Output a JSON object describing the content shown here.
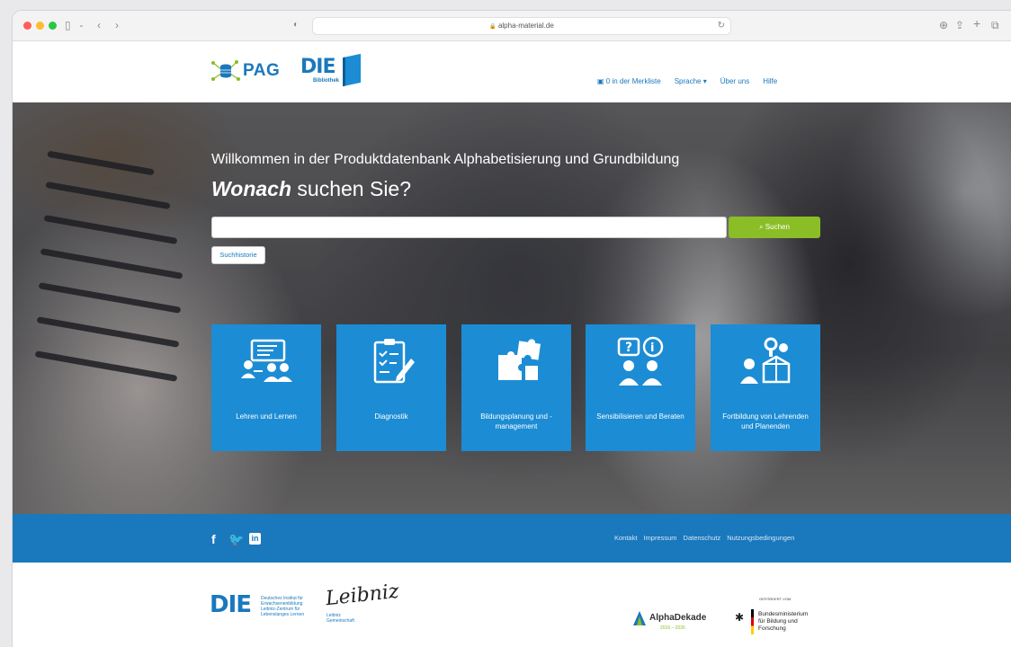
{
  "browser": {
    "url": "alpha-material.de",
    "secure_glyph": "🔒",
    "reload_icon": "↻",
    "shield_icon": "◐"
  },
  "header": {
    "logo_pag": "PAG",
    "logo_die": "DIE",
    "logo_die_sub": "Bibliothek",
    "nav": {
      "merkliste": "0 in der Merkliste",
      "sprache": "Sprache ▾",
      "ueber": "Über uns",
      "hilfe": "Hilfe"
    }
  },
  "hero": {
    "title": "Willkommen in der Produktdatenbank Alphabetisierung und Grundbildung",
    "subtitle_bold": "Wonach",
    "subtitle_rest": " suchen Sie?",
    "search_placeholder": "",
    "search_button": "Suchen",
    "history_button": "Suchhistorie"
  },
  "tiles": [
    {
      "label": "Lehren und Lernen",
      "icon": "teaching-icon"
    },
    {
      "label": "Diagnostik",
      "icon": "clipboard-icon"
    },
    {
      "label": "Bildungsplanung und -management",
      "icon": "puzzle-icon"
    },
    {
      "label": "Sensibilisieren und Beraten",
      "icon": "question-info-icon"
    },
    {
      "label": "Fortbildung von Lehrenden und Planenden",
      "icon": "toolbox-icon"
    }
  ],
  "footer": {
    "social": [
      "facebook-icon",
      "twitter-icon",
      "linkedin-icon"
    ],
    "links": [
      "Kontakt",
      "Impressum",
      "Datenschutz",
      "Nutzungsbedingungen"
    ]
  },
  "partners": {
    "die_text": "Deutsches Institut für Erwachsenenbildung Leibniz-Zentrum für Lebenslanges Lernen",
    "leibniz_sub": "Leibniz Gemeinschaft",
    "alphadekade": "AlphaDekade",
    "alphadekade_years": "2016 – 2026",
    "gefoerdert": "GEFÖRDERT VOM",
    "bmbf": "Bundesministerium für Bildung und Forschung"
  },
  "colors": {
    "brand_blue": "#1a78bd",
    "tile_blue": "#1c8cd4",
    "search_green": "#8bbd26"
  }
}
